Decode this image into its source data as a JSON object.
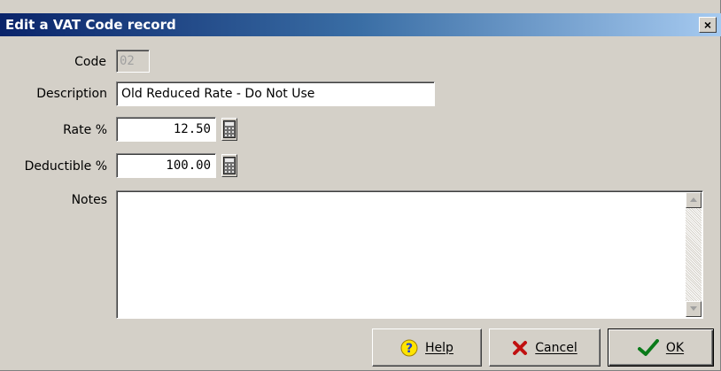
{
  "window": {
    "title": "Edit a VAT Code record",
    "close_label": "×"
  },
  "form": {
    "code": {
      "label": "Code",
      "value": "02"
    },
    "description": {
      "label": "Description",
      "value": "Old Reduced Rate - Do Not Use"
    },
    "rate": {
      "label": "Rate %",
      "value": "12.50"
    },
    "deductible": {
      "label": "Deductible %",
      "value": "100.00"
    },
    "notes": {
      "label": "Notes",
      "value": ""
    }
  },
  "buttons": {
    "help": {
      "label": "Help",
      "icon": "question-icon",
      "color": "#1a3fd1"
    },
    "cancel": {
      "label": "Cancel",
      "icon": "x-icon",
      "color": "#c01010"
    },
    "ok": {
      "label": "OK",
      "icon": "checkmark-icon",
      "color": "#0a7a1a"
    }
  },
  "colors": {
    "title_gradient_start": "#0a246a",
    "title_gradient_end": "#a6caf0",
    "dialog_face": "#d4d0c8"
  }
}
